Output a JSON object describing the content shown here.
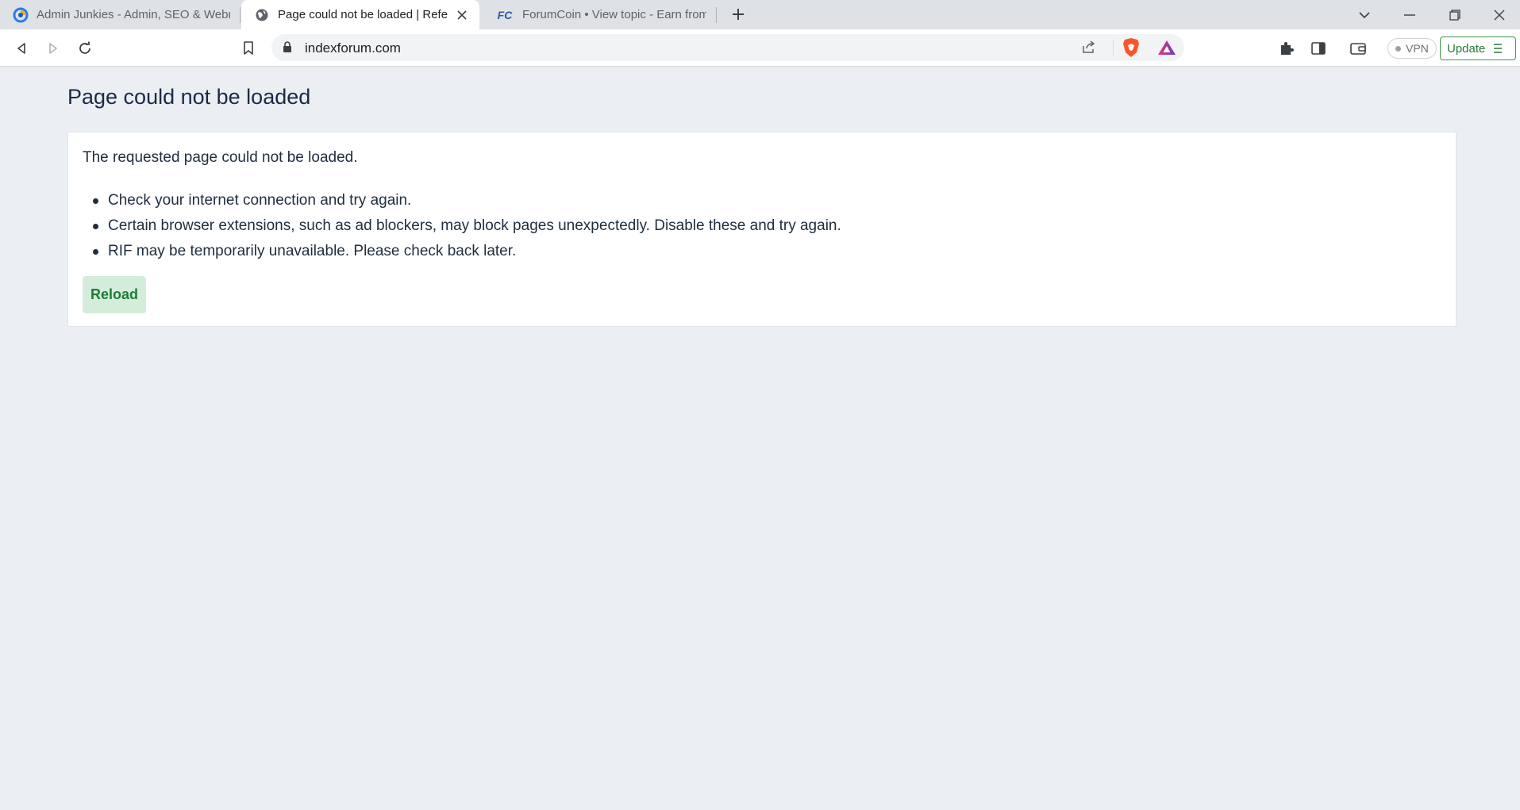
{
  "tabs": [
    {
      "title": "Admin Junkies - Admin, SEO & Webm",
      "favicon": "admin-junkies-logo-icon"
    },
    {
      "title": "Page could not be loaded | Referr",
      "favicon": "globe-icon",
      "active": true
    },
    {
      "title": "ForumCoin • View topic - Earn from Re",
      "favicon": "forumcoin-logo-icon",
      "favicon_text": "FC"
    }
  ],
  "toolbar": {
    "url": "indexforum.com",
    "vpn_label": "VPN",
    "update_label": "Update"
  },
  "page": {
    "title": "Page could not be loaded",
    "lead": "The requested page could not be loaded.",
    "items": [
      "Check your internet connection and try again.",
      "Certain browser extensions, such as ad blockers, may block pages unexpectedly. Disable these and try again.",
      "RIF may be temporarily unavailable. Please check back later."
    ],
    "reload_label": "Reload"
  },
  "colors": {
    "page_bg": "#ebeef3",
    "title": "#1a2b46",
    "reload_bg": "#d4edda",
    "reload_text": "#1e7e34",
    "update_border": "#3c9a4a"
  }
}
